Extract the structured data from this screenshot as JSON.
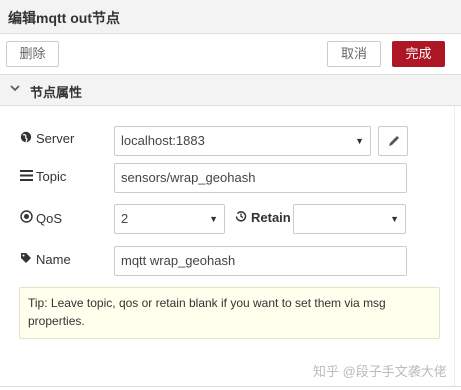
{
  "window": {
    "title": "编辑mqtt out节点"
  },
  "toolbar": {
    "delete_label": "删除",
    "cancel_label": "取消",
    "done_label": "完成"
  },
  "section": {
    "chevron": "⌄",
    "title": "节点属性"
  },
  "form": {
    "server": {
      "label": "Server",
      "icon": "globe-icon",
      "value": "localhost:1883"
    },
    "topic": {
      "label": "Topic",
      "icon": "tasks-icon",
      "value": "sensors/wrap_geohash"
    },
    "qos": {
      "label": "QoS",
      "icon": "empire-icon",
      "value": "2"
    },
    "retain": {
      "label": "Retain",
      "icon": "history-icon",
      "value": ""
    },
    "name": {
      "label": "Name",
      "icon": "tag-icon",
      "value": "mqtt wrap_geohash"
    }
  },
  "tip": "Tip: Leave topic, qos or retain blank if you want to set them via msg properties.",
  "watermark": "知乎 @段子手文袭大佬",
  "colors": {
    "accent": "#ad1625",
    "tip_bg": "#ffffee",
    "header_bg": "#f3f3f3"
  }
}
